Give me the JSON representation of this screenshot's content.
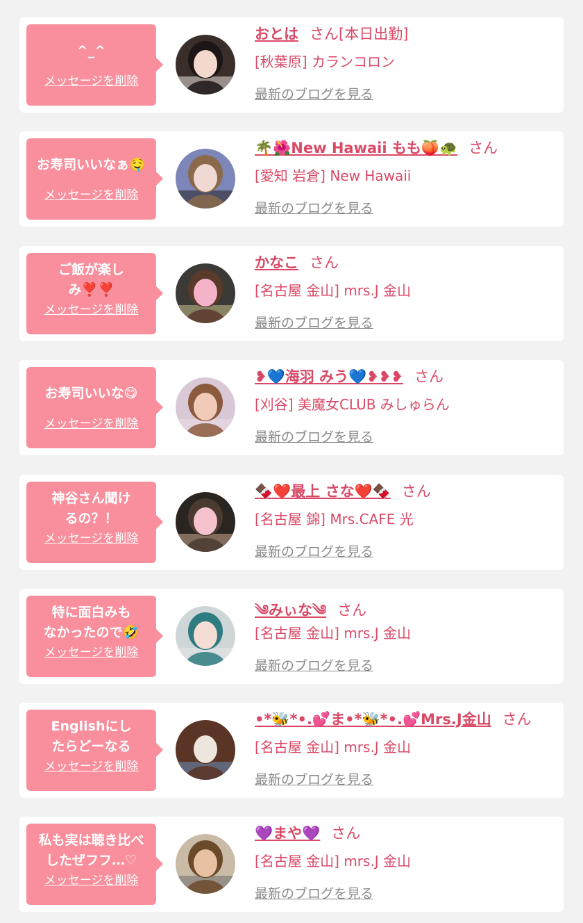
{
  "colors": {
    "accent": "#f98e9c",
    "name_text": "#d94966",
    "link_gray": "#888888",
    "background": "#f2f2f2"
  },
  "cards": [
    {
      "message": "^_^",
      "delete_label": "メッセージを削除",
      "name": "おとは",
      "honorific": "さん[本日出勤]",
      "shop": "[秋葉原] カランコロン",
      "blog_label": "最新のブログを見る",
      "avatar": {
        "bg": "#3a2e2a",
        "face": "#f3d8cc",
        "hair": "#1c1616",
        "accent": "#e9e2da"
      }
    },
    {
      "message": "お寿司いいなぁ🤤",
      "delete_label": "メッセージを削除",
      "name": "🌴🌺New Hawaii もも🍑🐢",
      "honorific": "さん",
      "shop": "[愛知 岩倉] New Hawaii",
      "blog_label": "最新のブログを見る",
      "avatar": {
        "bg": "#7d86b8",
        "face": "#f0d9d2",
        "hair": "#8a6a4a",
        "accent": "#222222"
      }
    },
    {
      "message": "ご飯が楽しみ❣️❣️",
      "delete_label": "メッセージを削除",
      "name": "かなこ",
      "honorific": "さん",
      "shop": "[名古屋 金山] mrs.J 金山",
      "blog_label": "最新のブログを見る",
      "avatar": {
        "bg": "#3b3a36",
        "face": "#f4b3c8",
        "hair": "#5a3a2a",
        "accent": "#c9c08a"
      }
    },
    {
      "message": "お寿司いいな😋",
      "delete_label": "メッセージを削除",
      "name": "❥💙海羽 みう💙❥❥❥",
      "honorific": "さん",
      "shop": "[刈谷] 美魔女CLUB みしゅらん",
      "blog_label": "最新のブログを見る",
      "avatar": {
        "bg": "#d9c8d6",
        "face": "#f1cbb8",
        "hair": "#8c5a3e",
        "accent": "#eadde6"
      }
    },
    {
      "message": "神谷さん聞けるの？！",
      "delete_label": "メッセージを削除",
      "name": "🍫❤️最上 さな❤️🍫",
      "honorific": "さん",
      "shop": "[名古屋 錦] Mrs.CAFE 光",
      "blog_label": "最新のブログを見る",
      "avatar": {
        "bg": "#2b2522",
        "face": "#f6c2cd",
        "hair": "#4a3a30",
        "accent": "#caa88e"
      }
    },
    {
      "message": "特に面白みもなかったので🤣",
      "delete_label": "メッセージを削除",
      "name": "༄みぃな༄",
      "honorific": "さん",
      "shop": "[名古屋 金山] mrs.J 金山",
      "blog_label": "最新のブログを見る",
      "avatar": {
        "bg": "#cfd6d8",
        "face": "#f3ddd4",
        "hair": "#2f7c80",
        "accent": "#e8e8e8"
      }
    },
    {
      "message": "Englishにしたらどーなる",
      "delete_label": "メッセージを削除",
      "name": "•*🐝*•.💕ま•*🐝*•.💕Mrs.J金山",
      "honorific": "さん",
      "shop": "[名古屋 金山] mrs.J 金山",
      "blog_label": "最新のブログを見る",
      "avatar": {
        "bg": "#5a3424",
        "face": "#ede6dc",
        "hair": "#5a3424",
        "accent": "#6a8fc0"
      }
    },
    {
      "message": "私も実は聴き比べしたぜフフ…♡",
      "delete_label": "メッセージを削除",
      "name": "💜まや💜",
      "honorific": "さん",
      "shop": "[名古屋 金山] mrs.J 金山",
      "blog_label": "最新のブログを見る",
      "avatar": {
        "bg": "#c9bba6",
        "face": "#e7c1a1",
        "hair": "#6b4a2a",
        "accent": "#6d6d6d"
      }
    }
  ]
}
